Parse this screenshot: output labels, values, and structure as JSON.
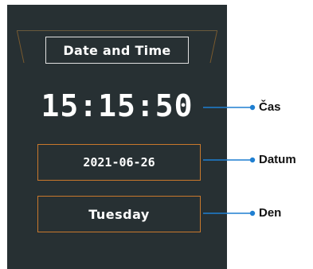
{
  "screen": {
    "title": "Date and Time",
    "time": "15:15:50",
    "date": "2021-06-26",
    "day": "Tuesday"
  },
  "callouts": {
    "time_label": "Čas",
    "date_label": "Datum",
    "day_label": "Den"
  },
  "colors": {
    "device_bg": "#273033",
    "field_border": "#c9782c",
    "callout_line": "#1f7fd1"
  }
}
